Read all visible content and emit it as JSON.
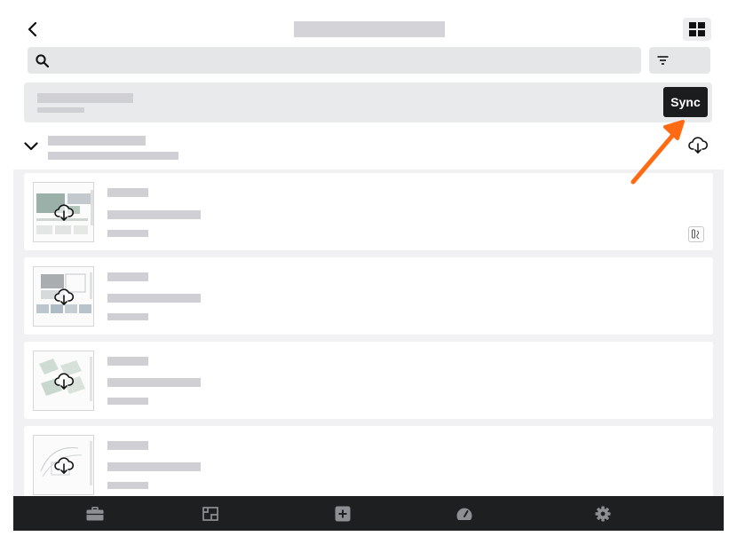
{
  "search": {
    "value": "",
    "placeholder": ""
  },
  "sync_button": {
    "label": "Sync"
  },
  "colors": {
    "accent_arrow": "#ff6a13",
    "nav_bar": "#1e1f21",
    "sync_button": "#1b1c1e"
  },
  "drawings": [
    {
      "status": "not-downloaded",
      "has_markup_badge": true
    },
    {
      "status": "not-downloaded",
      "has_markup_badge": false
    },
    {
      "status": "not-downloaded",
      "has_markup_badge": false
    },
    {
      "status": "not-downloaded",
      "has_markup_badge": false
    }
  ],
  "icons": {
    "back": "chevron-left-icon",
    "view_toggle": "grid-view-icon",
    "search": "search-icon",
    "filter": "filter-icon",
    "collapse": "chevron-down-icon",
    "download": "cloud-download-icon",
    "nav": [
      "briefcase-icon",
      "drawings-icon",
      "create-icon",
      "dashboard-icon",
      "settings-icon"
    ]
  }
}
